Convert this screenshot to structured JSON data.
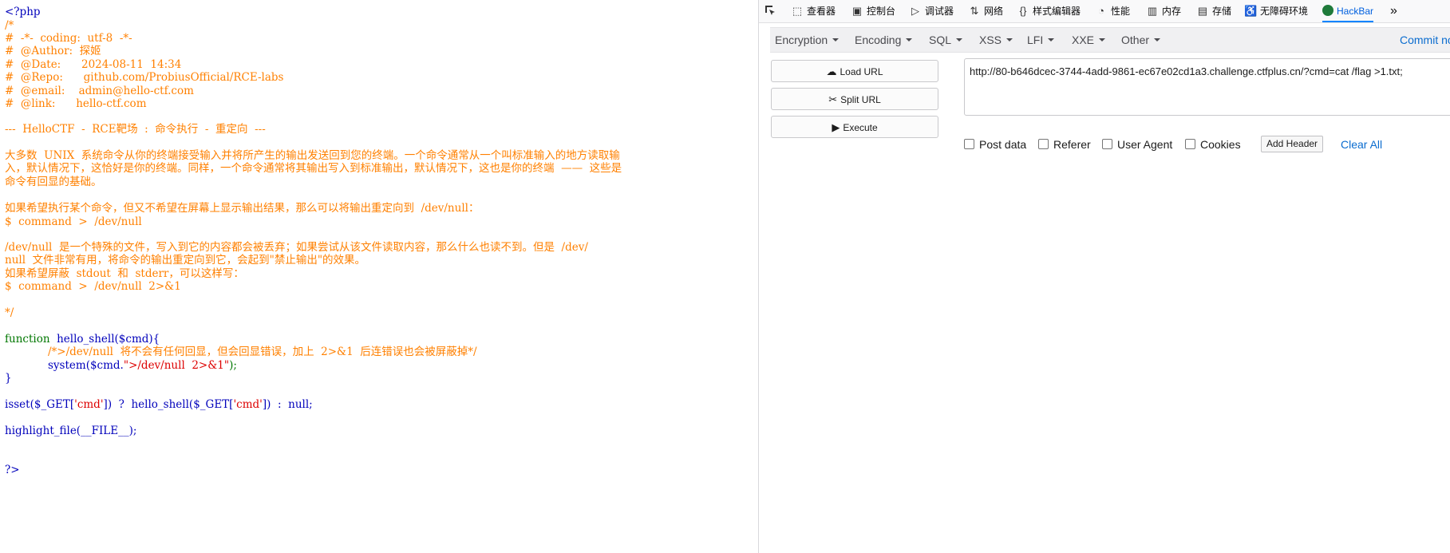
{
  "code": {
    "open_tag": "<?php",
    "comment_open": "/*",
    "header": [
      "#  -*-  coding:  utf-8  -*-",
      "#  @Author:  探姬",
      "#  @Date:      2024-08-11  14:34",
      "#  @Repo:      github.com/ProbiusOfficial/RCE-labs",
      "#  @email:    admin@hello-ctf.com",
      "#  @link:      hello-ctf.com"
    ],
    "banner": "---  HelloCTF  -  RCE靶场  :  命令执行  -  重定向  ---",
    "para1": [
      "大多数  UNIX  系统命令从你的终端接受输入并将所产生的输出发送回到您的终端。一个命令通常从一个叫标准输入的地方读取输",
      "入，默认情况下，这恰好是你的终端。同样，一个命令通常将其输出写入到标准输出，默认情况下，这也是你的终端  ——  这些是",
      "命令有回显的基础。"
    ],
    "para2": [
      "如果希望执行某个命令，但又不希望在屏幕上显示输出结果，那么可以将输出重定向到  /dev/null：",
      "$  command  >  /dev/null"
    ],
    "para3": [
      "/dev/null  是一个特殊的文件，写入到它的内容都会被丢弃；如果尝试从该文件读取内容，那么什么也读不到。但是  /dev/",
      "null  文件非常有用，将命令的输出重定向到它，会起到\"禁止输出\"的效果。",
      "如果希望屏蔽  stdout  和  stderr，可以这样写：",
      "$  command  >  /dev/null  2>&1"
    ],
    "comment_close": "*/",
    "fn_keyword": "function",
    "fn_name": "  hello_shell($cmd){",
    "inner_comment": "/*>/dev/null  将不会有任何回显，但会回显错误，加上  2>&1  后连错误也会被屏蔽掉*/",
    "sys_call": "system($cmd.",
    "sys_str": "\">/dev/null  2>&1\"",
    "sys_end": ");",
    "close_brace": "}",
    "isset_a": "isset($_GET[",
    "isset_b": "'cmd'",
    "isset_c": "])  ?  hello_shell($_GET[",
    "isset_d": "'cmd'",
    "isset_e": "])  :  null;",
    "highlight": "highlight_file(__FILE__);",
    "close_tag": "?>"
  },
  "devtools": {
    "tabs": [
      {
        "label": "查看器",
        "icon": "inspector-icon"
      },
      {
        "label": "控制台",
        "icon": "console-icon"
      },
      {
        "label": "调试器",
        "icon": "debugger-icon"
      },
      {
        "label": "网络",
        "icon": "network-icon"
      },
      {
        "label": "样式编辑器",
        "icon": "style-editor-icon"
      },
      {
        "label": "性能",
        "icon": "performance-icon"
      },
      {
        "label": "内存",
        "icon": "memory-icon"
      },
      {
        "label": "存储",
        "icon": "storage-icon"
      },
      {
        "label": "无障碍环境",
        "icon": "accessibility-icon"
      },
      {
        "label": "HackBar",
        "icon": "hackbar-icon"
      }
    ],
    "active_tab": "HackBar"
  },
  "hackbar": {
    "menu": [
      "Encryption",
      "Encoding",
      "SQL",
      "XSS",
      "LFI",
      "XXE",
      "Other"
    ],
    "commit": "Commit now",
    "buttons": {
      "load": "Load URL",
      "split": "Split URL",
      "execute": "Execute"
    },
    "url": "http://80-b646dcec-3744-4add-9861-ec67e02cd1a3.challenge.ctfplus.cn/?cmd=cat /flag >1.txt;",
    "options": [
      "Post data",
      "Referer",
      "User Agent",
      "Cookies"
    ],
    "add_header": "Add Header",
    "clear_all": "Clear All"
  },
  "colors": {
    "keyword": "#007700",
    "default": "#0000bb",
    "string": "#dd0000",
    "comment": "#ff8000",
    "link": "#0a6ccf"
  }
}
